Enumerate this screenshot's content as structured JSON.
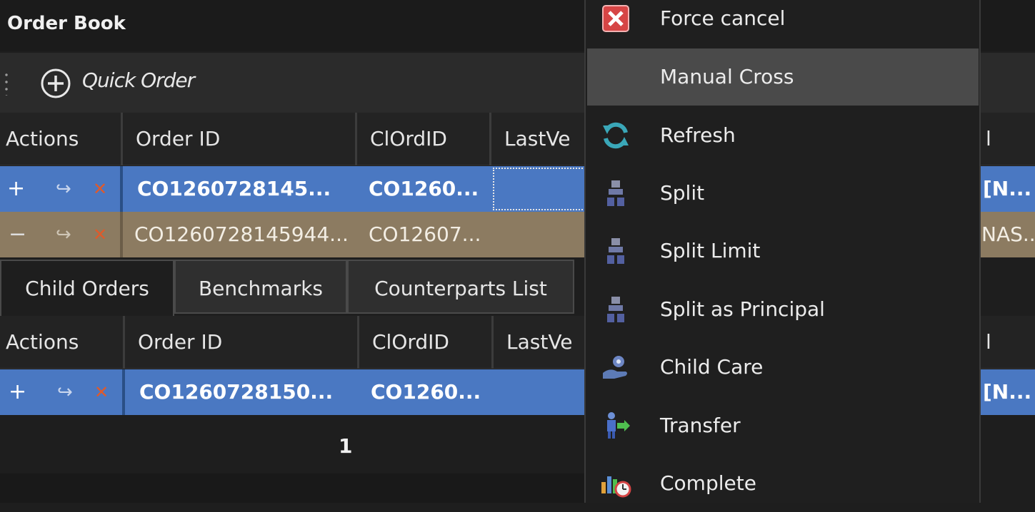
{
  "title": "Order Book",
  "toolbar": {
    "quick_order": "Quick Order"
  },
  "main_grid": {
    "headers": [
      "Actions",
      "Order ID",
      "ClOrdID",
      "LastVe",
      "l"
    ],
    "rows": [
      {
        "expand": "+",
        "order_id": "CO1260728145...",
        "clordid": "CO1260...",
        "last": "",
        "tail": "[N..."
      },
      {
        "expand": "−",
        "order_id": "CO1260728145944...",
        "clordid": "CO12607...",
        "last": "",
        "tail": "NAS..."
      }
    ]
  },
  "tabs": [
    "Child Orders",
    "Benchmarks",
    "Counterparts List"
  ],
  "child_grid": {
    "headers": [
      "Actions",
      "Order ID",
      "ClOrdID",
      "LastVe",
      "l"
    ],
    "rows": [
      {
        "expand": "+",
        "order_id": "CO1260728150...",
        "clordid": "CO1260...",
        "last": "",
        "tail": "[N..."
      }
    ]
  },
  "pager": {
    "page": "1"
  },
  "context_menu": {
    "items": [
      {
        "label": "Force cancel",
        "icon": "force-cancel-icon"
      },
      {
        "label": "Manual Cross",
        "icon": ""
      },
      {
        "label": "Refresh",
        "icon": "refresh-icon"
      },
      {
        "label": "Split",
        "icon": "split-icon"
      },
      {
        "label": "Split Limit",
        "icon": "split-limit-icon"
      },
      {
        "label": "Split as Principal",
        "icon": "split-principal-icon"
      },
      {
        "label": "Child Care",
        "icon": "child-care-icon"
      },
      {
        "label": "Transfer",
        "icon": "transfer-icon"
      },
      {
        "label": "Complete",
        "icon": "complete-icon"
      }
    ]
  },
  "glyphs": {
    "forward": "↪",
    "cancel": "✕"
  },
  "colors": {
    "selected_row": "#4a78c2",
    "parent_row": "#8c7b61",
    "cancel_x": "#e05a2a",
    "menu_highlight": "#4a4a4a"
  }
}
